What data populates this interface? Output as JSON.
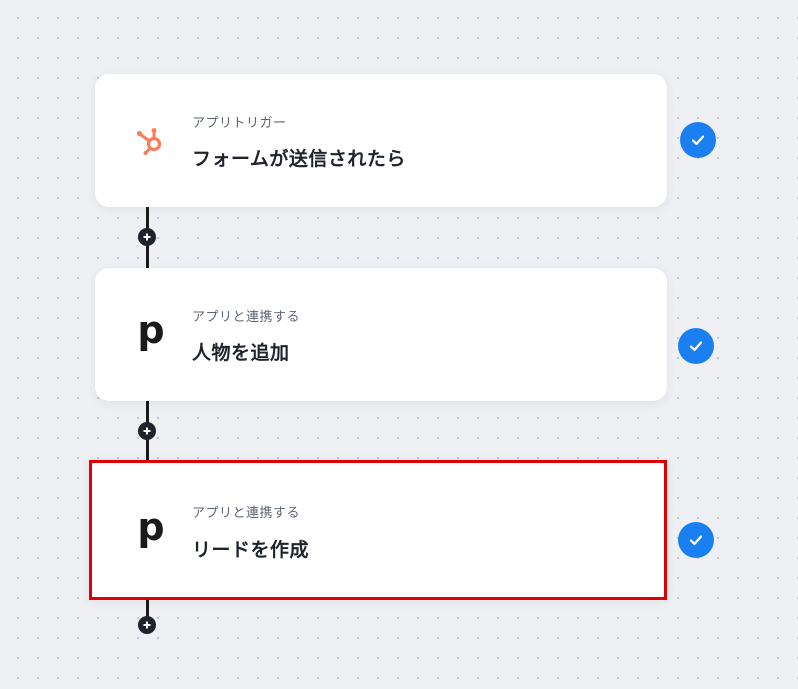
{
  "steps": [
    {
      "subtitle": "アプリトリガー",
      "title": "フォームが送信されたら",
      "app_icon": "hubspot-icon",
      "status_icon": "check-icon"
    },
    {
      "subtitle": "アプリと連携する",
      "title": "人物を追加",
      "app_icon": "pipedrive-icon",
      "logo_letter": "p",
      "status_icon": "check-icon"
    },
    {
      "subtitle": "アプリと連携する",
      "title": "リードを作成",
      "app_icon": "pipedrive-icon",
      "logo_letter": "p",
      "status_icon": "check-icon",
      "highlighted": true
    }
  ],
  "colors": {
    "canvas_background": "#eef0f4",
    "check_blue": "#1a7ff0",
    "hubspot_orange": "#ff7a59",
    "highlight_red": "#e10000",
    "connector": "#1a1a1a"
  },
  "add_step_icon": "plus-icon"
}
